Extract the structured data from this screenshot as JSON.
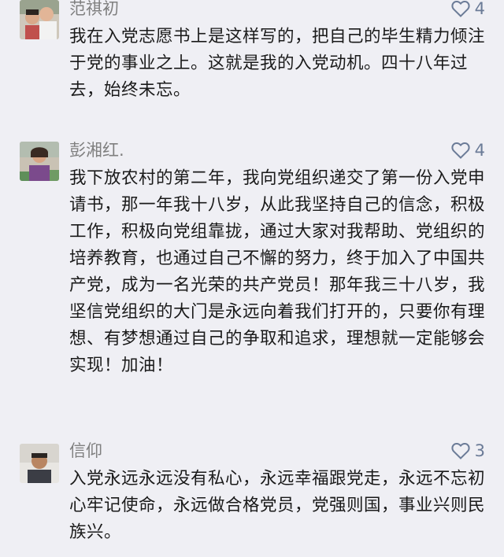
{
  "comments": [
    {
      "name": "范祺初",
      "likes": "4",
      "text": "我在入党志愿书上是这样写的，把自己的毕生精力倾注于党的事业之上。这就是我的入党动机。四十八年过去，始终未忘。"
    },
    {
      "name": "彭湘红.",
      "likes": "4",
      "text": "我下放农村的第二年，我向党组织递交了第一份入党申请书，那一年我十八岁，从此我坚持自己的信念，积极工作，积极向党组靠拢，通过大家对我帮助、党组织的培养教育，也通过自己不懈的努力，终于加入了中国共产党，成为一名光荣的共产党员！那年我三十八岁，我坚信党组织的大门是永远向着我们打开的，只要你有理想、有梦想通过自己的争取和追求，理想就一定能够会实现！加油！"
    },
    {
      "name": "信仰",
      "likes": "3",
      "text": "入党永远永远没有私心，永远幸福跟党走，永远不忘初心牢记使命，永远做合格党员，党强则国，事业兴则民族兴。"
    }
  ],
  "colors": {
    "background": "#efeff4",
    "name": "#7f7f7f",
    "like": "#6b7b97",
    "text": "#1a1a1a"
  }
}
